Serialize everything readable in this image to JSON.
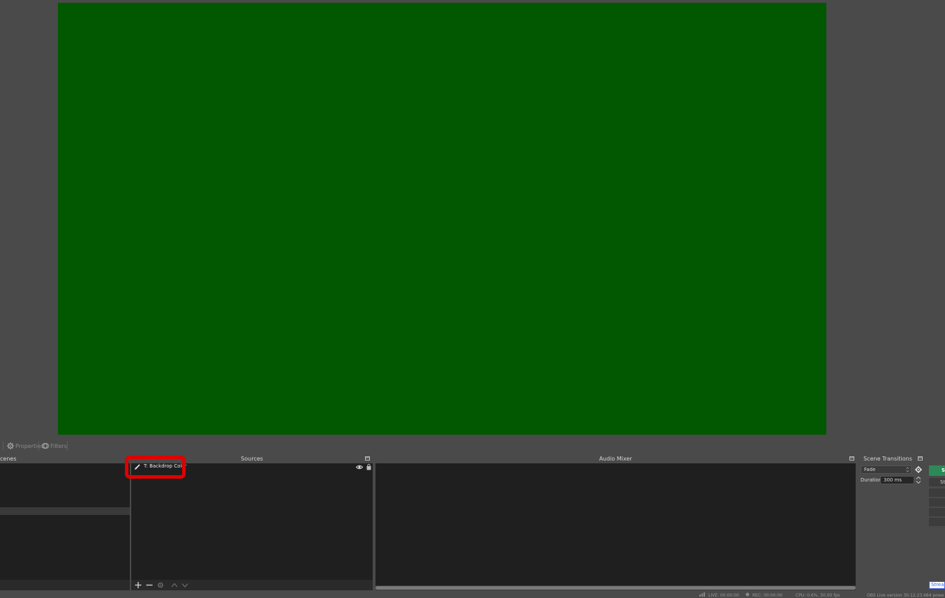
{
  "toolbar": {
    "properties_label": "Properties",
    "filters_label": "Filters"
  },
  "scenes": {
    "title": "cenes"
  },
  "sources": {
    "title": "Sources",
    "items": [
      {
        "label": "T: Backdrop Color",
        "icon": "brush-icon"
      }
    ],
    "controls": [
      "add-icon",
      "remove-icon",
      "gear-icon",
      "chevron-up-icon",
      "chevron-down-icon"
    ]
  },
  "audio_mixer": {
    "title": "Audio Mixer"
  },
  "scene_transitions": {
    "title": "Scene Transitions",
    "transition_value": "Fade",
    "duration_label": "Duration",
    "duration_value": "300 ms"
  },
  "controls": {
    "start_streaming_fragment": "S",
    "start_recording_fragment": "St",
    "stream_fragment": "Stream"
  },
  "status": {
    "live": "LIVE: 00:00:00",
    "rec": "REC: 00:00:00",
    "cpu": "CPU: 0.6%, 30.00 fps",
    "version": "OBS Live version 30.12.23.684 powe"
  },
  "colors": {
    "preview_background": "#015800",
    "highlight": "#e10000",
    "accent_green": "#2b8a57",
    "stream_blue": "#3a5bdc"
  }
}
